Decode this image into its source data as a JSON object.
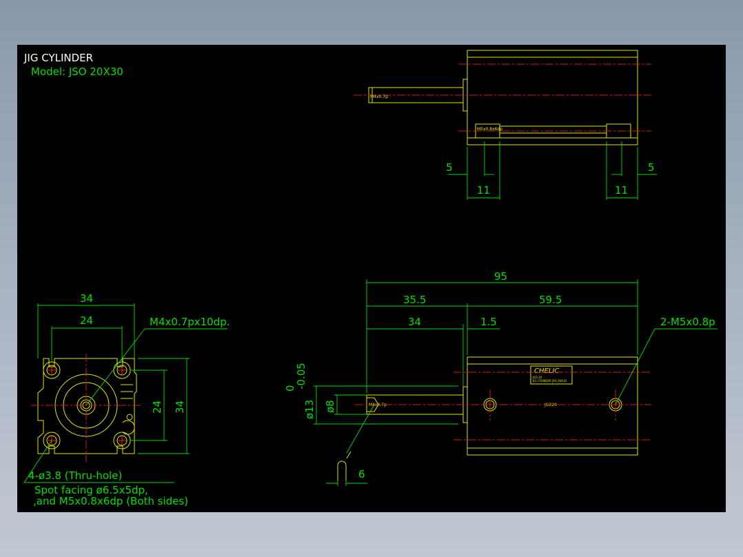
{
  "title": "JIG CYLINDER",
  "model": "Model: JSO 20X30",
  "brand": "CHELIC",
  "plate_lines": [
    "JSO 20",
    "JIG CYLINDER JSO 20X30"
  ],
  "labels": {
    "port_rod": "M4x0.7p",
    "port_top": "M5x0.8x6dp",
    "body_mark": "JSO20",
    "tap": "M4x0.7px10dp.",
    "ports": "2-M5x0.8p",
    "holes": "4-ø3.8 (Thru-hole)",
    "spot1": "Spot facing ø6.5x5dp,",
    "spot2": ",and M5x0.8x6dp (Both sides)"
  },
  "dims": {
    "d34w": "34",
    "d24w": "24",
    "d24h": "24",
    "d34h": "34",
    "d95": "95",
    "d355": "35.5",
    "d595": "59.5",
    "d34": "34",
    "d15": "1.5",
    "d13": "ø13",
    "tol_up": "0",
    "tol_lo": "-0.05",
    "d8": "ø8",
    "d6": "6",
    "t5l": "5",
    "t11l": "11",
    "t5r": "5",
    "t11r": "11"
  },
  "colors": {
    "background": "#000000",
    "dimension": "#00e000",
    "outline": "#e6e600",
    "centerline": "#d81818",
    "title": "#ffffff"
  }
}
